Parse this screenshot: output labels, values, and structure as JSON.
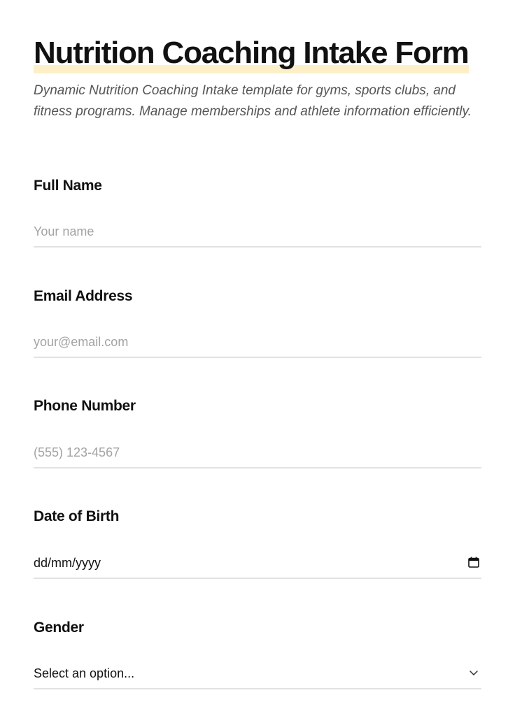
{
  "form": {
    "title": "Nutrition Coaching Intake Form",
    "description": "Dynamic Nutrition Coaching Intake template for gyms, sports clubs, and fitness programs. Manage memberships and athlete information efficiently."
  },
  "fields": {
    "full_name": {
      "label": "Full Name",
      "placeholder": "Your name",
      "value": ""
    },
    "email": {
      "label": "Email Address",
      "placeholder": "your@email.com",
      "value": ""
    },
    "phone": {
      "label": "Phone Number",
      "placeholder": "(555) 123-4567",
      "value": ""
    },
    "date_of_birth": {
      "label": "Date of Birth",
      "value": "dd/mm/yyyy",
      "icon": "calendar-icon"
    },
    "gender": {
      "label": "Gender",
      "selected": "Select an option...",
      "icon": "chevron-down-icon"
    }
  },
  "colors": {
    "title_highlight": "#fdf0c8",
    "text": "#111111",
    "muted_text": "#555555",
    "placeholder": "#a3a3a3",
    "underline": "#e2e2e2"
  }
}
